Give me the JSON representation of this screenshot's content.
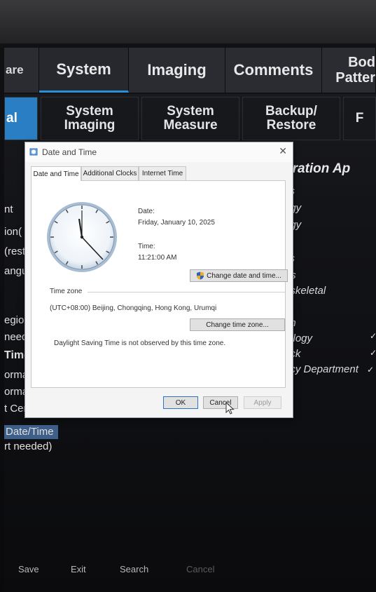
{
  "main_tabs": [
    {
      "label": "are"
    },
    {
      "label": "System"
    },
    {
      "label": "Imaging"
    },
    {
      "label": "Comments"
    },
    {
      "label": "Bod"
    },
    {
      "label": "Patter"
    }
  ],
  "sub_tabs": [
    {
      "label": "al"
    },
    {
      "line1": "System",
      "line2": "Imaging"
    },
    {
      "line1": "System",
      "line2": "Measure"
    },
    {
      "line1": "Backup/",
      "line2": "Restore"
    },
    {
      "label": "F"
    }
  ],
  "left_list": [
    "nt",
    "ion(",
    "(rest",
    "angua",
    "egion",
    "neede",
    "Time",
    "ormat",
    "ormat",
    "t Centu",
    "Date/Time",
    "rt needed)"
  ],
  "right_list": {
    "heading": "uration Ap",
    "items": [
      "cs",
      "ogy",
      "ogy",
      "cs",
      "rts",
      "oskeletal",
      "en",
      "tology",
      "ock",
      "ncy Department"
    ]
  },
  "bottom_bar": [
    "Save",
    "Exit",
    "Search",
    "Cancel"
  ],
  "dialog": {
    "title": "Date and Time",
    "close_icon": "close-icon",
    "tabs": [
      "Date and Time",
      "Additional Clocks",
      "Internet Time"
    ],
    "date_label": "Date:",
    "date_value": "Friday, January 10, 2025",
    "time_label": "Time:",
    "time_value": "11:21:00 AM",
    "change_date_button": "Change date and time...",
    "time_zone_label": "Time zone",
    "time_zone_value": "(UTC+08:00) Beijing, Chongqing, Hong Kong, Urumqi",
    "change_zone_button": "Change time zone...",
    "dst_note": "Daylight Saving Time is not observed by this time zone.",
    "ok_button": "OK",
    "cancel_button": "Cancel",
    "apply_button": "Apply"
  },
  "colors": {
    "accent_blue": "#2a7fc4",
    "tab_underline": "#2a8fd6",
    "shield_blue": "#2f5fbf",
    "shield_gold": "#e8b11c"
  }
}
